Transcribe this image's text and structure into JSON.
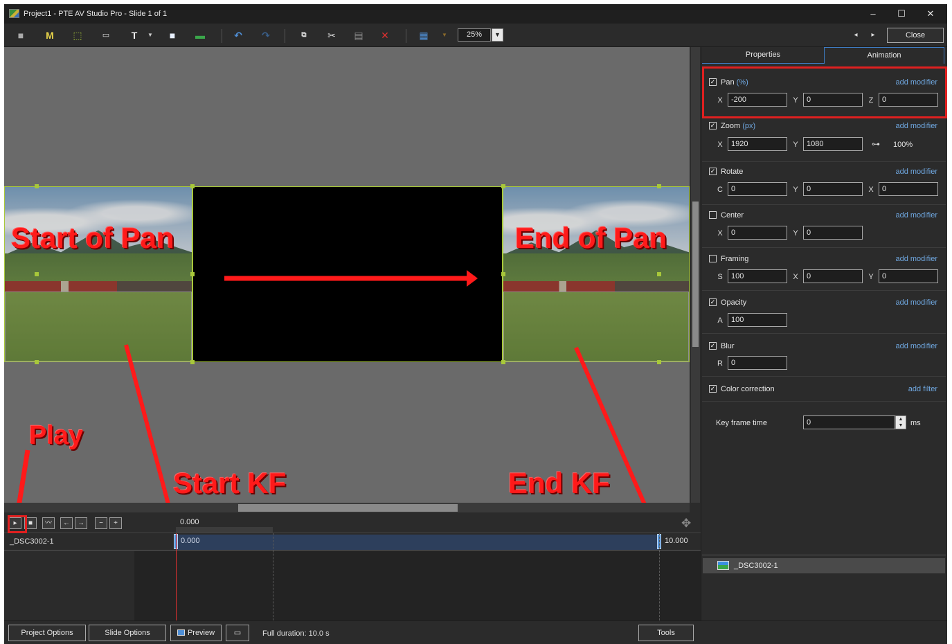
{
  "window": {
    "title": "Project1 - PTE AV Studio Pro - Slide 1 of 1",
    "minimize": "–",
    "maximize": "☐",
    "close": "✕"
  },
  "toolbar": {
    "zoom_value": "25%",
    "close_label": "Close",
    "nav_prev": "◂",
    "nav_next": "▸"
  },
  "annotations": {
    "start_of_pan": "Start of Pan",
    "end_of_pan": "End of Pan",
    "play": "Play",
    "start_kf": "Start KF",
    "end_kf": "End KF"
  },
  "timeline": {
    "ruler_time": "0.000",
    "track_name": "_DSC3002-1",
    "start_time": "0.000",
    "end_time": "10.000"
  },
  "panel": {
    "tabs": [
      "Properties",
      "Animation"
    ],
    "active_tab": "Animation",
    "pan": {
      "label": "Pan",
      "unit": "(%)",
      "checked": true,
      "add": "add modifier",
      "x_label": "X",
      "x": "-200",
      "y_label": "Y",
      "y": "0",
      "z_label": "Z",
      "z": "0"
    },
    "zoom": {
      "label": "Zoom",
      "unit": "(px)",
      "checked": true,
      "add": "add modifier",
      "x_label": "X",
      "x": "1920",
      "y_label": "Y",
      "y": "1080",
      "percent": "100%"
    },
    "rotate": {
      "label": "Rotate",
      "checked": true,
      "add": "add modifier",
      "c_label": "C",
      "c": "0",
      "y_label": "Y",
      "y": "0",
      "x_label": "X",
      "x": "0"
    },
    "center": {
      "label": "Center",
      "checked": false,
      "add": "add modifier",
      "x_label": "X",
      "x": "0",
      "y_label": "Y",
      "y": "0"
    },
    "framing": {
      "label": "Framing",
      "checked": false,
      "add": "add modifier",
      "s_label": "S",
      "s": "100",
      "x_label": "X",
      "x": "0",
      "y_label": "Y",
      "y": "0"
    },
    "opacity": {
      "label": "Opacity",
      "checked": true,
      "add": "add modifier",
      "a_label": "A",
      "a": "100"
    },
    "blur": {
      "label": "Blur",
      "checked": true,
      "add": "add modifier",
      "r_label": "R",
      "r": "0"
    },
    "color": {
      "label": "Color correction",
      "checked": true,
      "add": "add filter"
    },
    "keyframe": {
      "label": "Key frame time",
      "value": "0",
      "unit": "ms"
    },
    "object_list": [
      "_DSC3002-1"
    ]
  },
  "statusbar": {
    "project_options": "Project Options",
    "slide_options": "Slide Options",
    "preview": "Preview",
    "full_duration": "Full duration: 10.0 s",
    "tools": "Tools"
  },
  "colors": {
    "accent_blue": "#6fa7e0",
    "annotation_red": "#ff1a1a",
    "selection_green": "#a8c83a"
  }
}
